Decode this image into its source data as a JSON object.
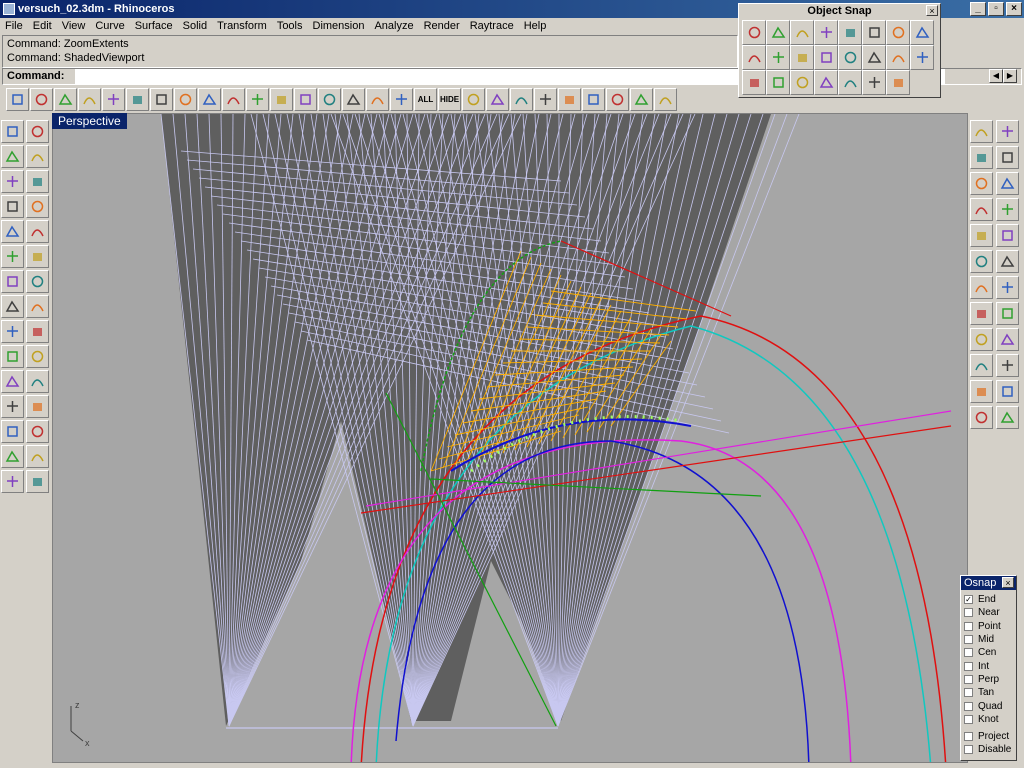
{
  "window": {
    "title": "versuch_02.3dm - Rhinoceros"
  },
  "menu": [
    "File",
    "Edit",
    "View",
    "Curve",
    "Surface",
    "Solid",
    "Transform",
    "Tools",
    "Dimension",
    "Analyze",
    "Render",
    "Raytrace",
    "Help"
  ],
  "history": [
    "Command: ZoomExtents",
    "Command: ShadedViewport"
  ],
  "command": {
    "label": "Command:",
    "value": ""
  },
  "viewport": {
    "label": "Perspective"
  },
  "toolbar_top": [
    "new-file",
    "open-folder",
    "save",
    "cut",
    "copy",
    "paste",
    "undo",
    "pan-hand",
    "rotate-view",
    "zoom-dynamic",
    "zoom-window",
    "zoom-target",
    "zoom-extents",
    "zoom-all",
    "four-views",
    "car",
    "mesh-tool",
    "show-all",
    "hide",
    "layer",
    "color-wheel",
    "sphere-gray",
    "sphere-blue",
    "light",
    "settings",
    "dimension",
    "help",
    "properties"
  ],
  "toolbar_top_labels": {
    "show-all": "ALL",
    "hide": "HIDE"
  },
  "left_tools": [
    "select-arrow",
    "point",
    "polyline",
    "curve",
    "circle",
    "ellipse",
    "arc",
    "rectangle",
    "polygon",
    "fillet",
    "surface-patch",
    "surface-loft",
    "box",
    "solid-union",
    "mesh",
    "mesh-boolean",
    "text-edit",
    "transform",
    "align",
    "array",
    "dimension",
    "trim",
    "split",
    "offset",
    "text",
    "snap-grid",
    "grid-array",
    "layout",
    "named-view",
    "render-tool"
  ],
  "right_tools": [
    "extrude",
    "pipe",
    "revolve",
    "sweep",
    "blend",
    "fillet-edge",
    "network",
    "patch",
    "bend",
    "twist",
    "box-edit",
    "cylinder",
    "curve-offset",
    "match",
    "control-points",
    "rebuild",
    "project",
    "split-edge",
    "mirror",
    "align-edge",
    "undo-view",
    "hidden",
    "show-points",
    "cplane"
  ],
  "object_snap_palette": {
    "title": "Object Snap",
    "tools": [
      "snap-center",
      "snap-end",
      "snap-mid",
      "snap-point",
      "snap-near",
      "snap-quad",
      "snap-perp",
      "snap-tan",
      "snap-int",
      "snap-knot",
      "snap-from",
      "snap-along",
      "snap-between",
      "snap-cplane",
      "snap-perp-from",
      "snap-tan-from",
      "snap-vertex",
      "snap-curve",
      "snap-surface",
      "snap-line",
      "snap-disable-1",
      "snap-disable-2",
      "snap-disable-3"
    ]
  },
  "osnap_panel": {
    "title": "Osnap",
    "items": [
      {
        "label": "End",
        "checked": true
      },
      {
        "label": "Near",
        "checked": false
      },
      {
        "label": "Point",
        "checked": false
      },
      {
        "label": "Mid",
        "checked": false
      },
      {
        "label": "Cen",
        "checked": false
      },
      {
        "label": "Int",
        "checked": false
      },
      {
        "label": "Perp",
        "checked": false
      },
      {
        "label": "Tan",
        "checked": false
      },
      {
        "label": "Quad",
        "checked": false
      },
      {
        "label": "Knot",
        "checked": false
      }
    ],
    "extras": [
      {
        "label": "Project",
        "checked": false
      },
      {
        "label": "Disable",
        "checked": false
      }
    ]
  },
  "axes": {
    "x": "x",
    "z": "z"
  },
  "colors": {
    "titlebar": "#0a246a",
    "viewport": "#a6a6a6",
    "fan": "#c8c8f0",
    "surface_dark": "#5f5f5f",
    "red": "#e01010",
    "cyan": "#10c8c0",
    "magenta": "#e020e0",
    "blue": "#1010d0",
    "green": "#10a010",
    "yellow": "#ffb000"
  }
}
